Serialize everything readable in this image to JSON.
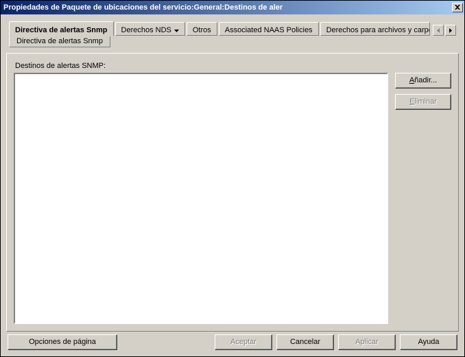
{
  "window": {
    "title": "Propiedades de Paquete de ubicaciones del servicio:General:Destinos de aler"
  },
  "tabs": {
    "t0": "Directiva de alertas Snmp",
    "t1": "Derechos NDS",
    "t2": "Otros",
    "t3": "Associated NAAS Policies",
    "t4": "Derechos para archivos y carpetas",
    "sub0": "Directiva de alertas Snmp"
  },
  "panel": {
    "section_label": "Destinos de alertas SNMP:"
  },
  "side": {
    "add": "Añadir...",
    "delete": "Eliminar"
  },
  "bottom": {
    "page_options": "Opciones de página",
    "accept": "Aceptar",
    "cancel": "Cancelar",
    "apply": "Aplicar",
    "help": "Ayuda"
  }
}
